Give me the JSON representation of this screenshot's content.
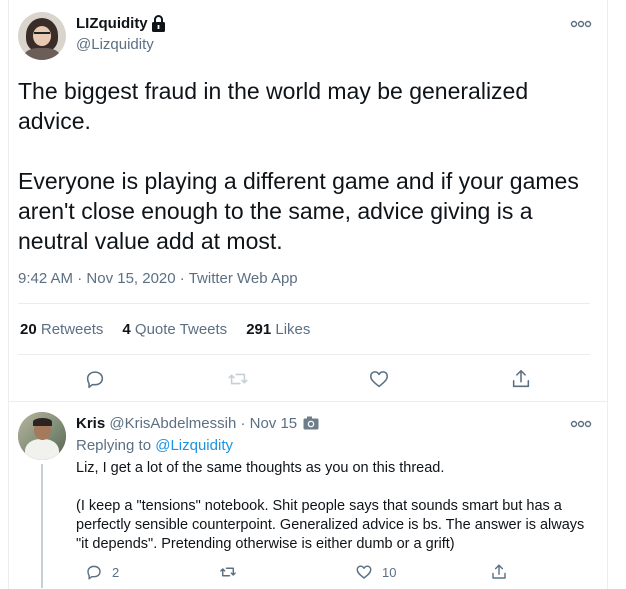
{
  "tweet": {
    "author": {
      "name": "LIZquidity",
      "handle": "@Lizquidity",
      "protected_icon": "lock-icon"
    },
    "text": "The biggest fraud in the world may be generalized advice.\n\nEveryone is playing a different game and if your games aren't close enough to the same, advice giving is a neutral value add at most.",
    "time": "9:42 AM",
    "separator": " · ",
    "date": "Nov 15, 2020",
    "source": "Twitter Web App",
    "stats": {
      "retweets_count": "20",
      "retweets_label": " Retweets",
      "quotes_count": "4",
      "quotes_label": " Quote Tweets",
      "likes_count": "291",
      "likes_label": " Likes"
    },
    "actions": [
      "reply-icon",
      "retweet-icon",
      "like-icon",
      "share-icon"
    ]
  },
  "reply": {
    "author": {
      "name": "Kris",
      "handle": "@KrisAbdelmessih",
      "time": " · Nov 15"
    },
    "replying_to_label": "Replying to ",
    "replying_to_mention": "@Lizquidity",
    "text": "Liz, I get a lot of the same thoughts as you on this thread.\n\n(I keep a \"tensions\" notebook. Shit people says that sounds smart but has a perfectly sensible counterpoint. Generalized advice is bs. The answer is always \"it depends\". Pretending otherwise is either dumb or a grift)",
    "reply_count": "2",
    "like_count": "10"
  },
  "colors": {
    "text": "#0f1419",
    "secondary": "#5b7083",
    "link": "#1b95e0",
    "divider": "#ebeef0"
  }
}
